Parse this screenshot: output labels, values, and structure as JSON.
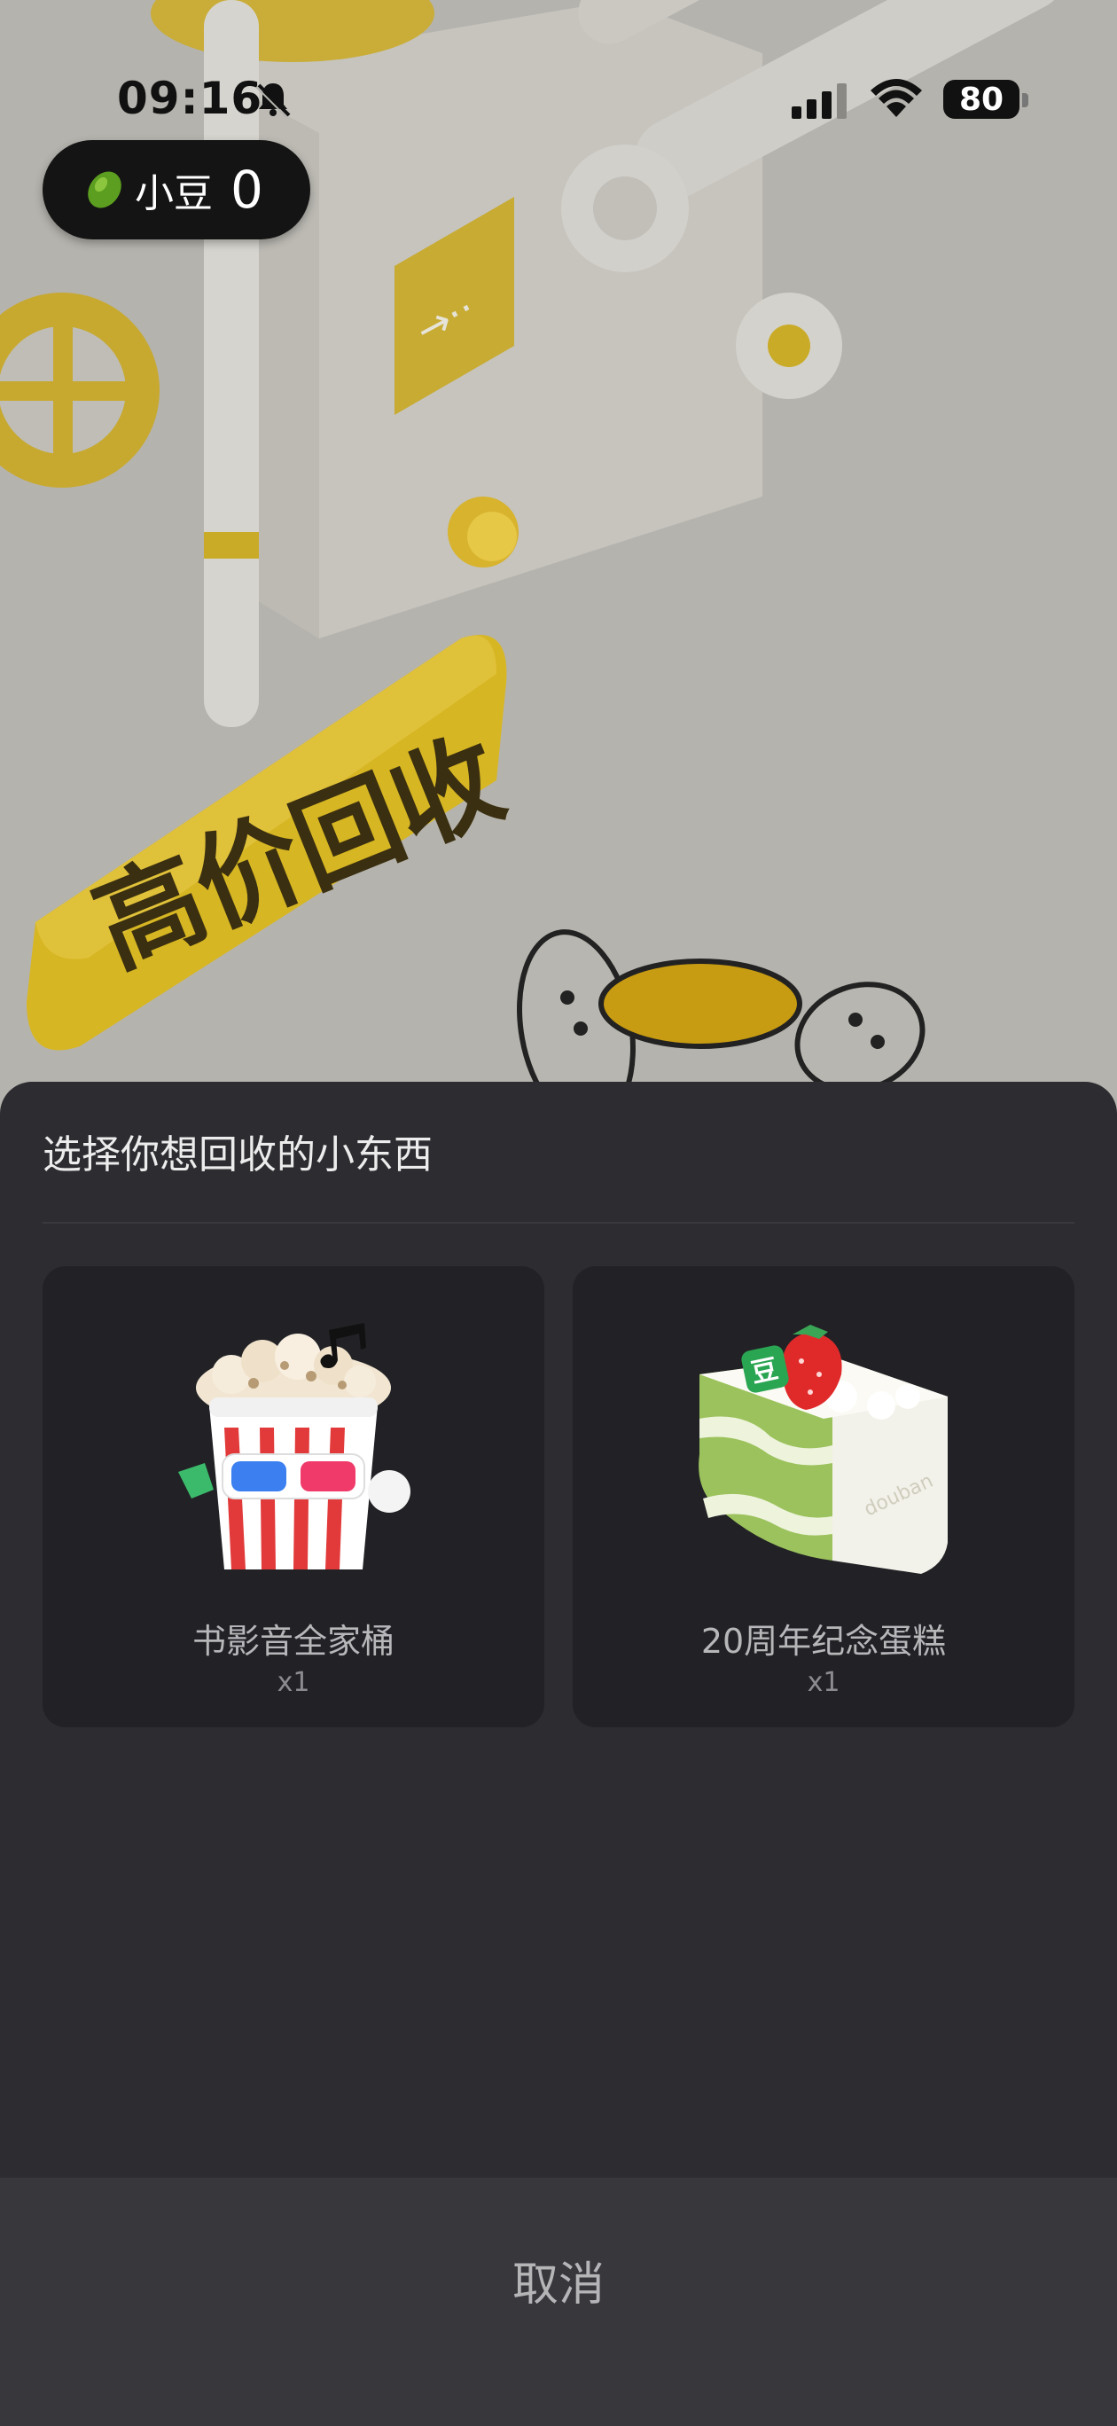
{
  "status_bar": {
    "time": "09:16",
    "battery": "80",
    "icons": [
      "bell-muted-icon",
      "cellular-signal-icon",
      "wifi-icon",
      "battery-icon"
    ]
  },
  "banner": {
    "text": "高价回收"
  },
  "bean_counter": {
    "label": "小豆",
    "count": "0",
    "icon": "bean-icon"
  },
  "sheet": {
    "title": "选择你想回收的小东西",
    "items": [
      {
        "name": "书影音全家桶",
        "qty": "x1",
        "icon": "popcorn-bucket-icon"
      },
      {
        "name": "20周年纪念蛋糕",
        "qty": "x1",
        "icon": "cake-slice-icon"
      }
    ],
    "cancel_label": "取消"
  },
  "colors": {
    "sheet_bg": "#2d2c31",
    "card_bg": "#222226",
    "cancel_bg": "#38373c",
    "machine_yellow": "#e4c42a"
  }
}
